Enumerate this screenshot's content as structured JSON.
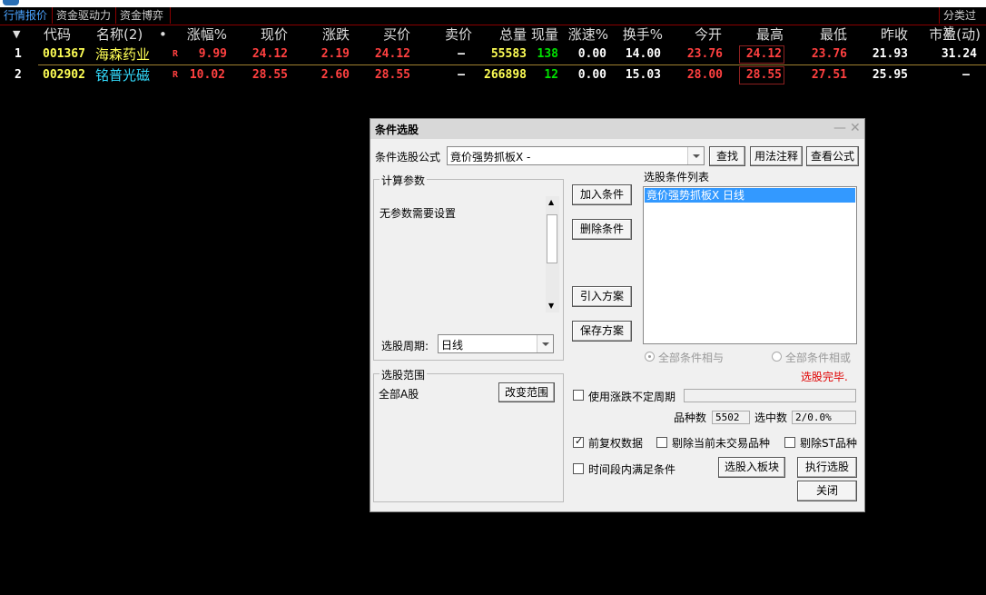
{
  "tabs": [
    "行情报价",
    "资金驱动力",
    "资金博弈"
  ],
  "tab_right": "分类过滤",
  "columns": [
    "代码",
    "名称(2)",
    "•",
    "涨幅%",
    "现价",
    "涨跌",
    "买价",
    "卖价",
    "总量",
    "现量",
    "涨速%",
    "换手%",
    "今开",
    "最高",
    "最低",
    "昨收",
    "市盈(动)"
  ],
  "rows": [
    {
      "idx": "1",
      "code": "001367",
      "name": "海森药业",
      "flag": "R",
      "chg_pct": "9.99",
      "price": "24.12",
      "chg": "2.19",
      "bid": "24.12",
      "ask": "–",
      "vol": "55583",
      "cur_vol": "138",
      "speed": "0.00",
      "turnover": "14.00",
      "open": "23.76",
      "high": "24.12",
      "low": "23.76",
      "prev": "21.93",
      "pe": "31.24"
    },
    {
      "idx": "2",
      "code": "002902",
      "name": "铭普光磁",
      "flag": "R",
      "chg_pct": "10.02",
      "price": "28.55",
      "chg": "2.60",
      "bid": "28.55",
      "ask": "–",
      "vol": "266898",
      "cur_vol": "12",
      "speed": "0.00",
      "turnover": "15.03",
      "open": "28.00",
      "high": "28.55",
      "low": "27.51",
      "prev": "25.95",
      "pe": "–"
    }
  ],
  "dialog": {
    "title": "条件选股",
    "formula_label": "条件选股公式",
    "formula_value": "竟价强势抓板X  -",
    "find": "查找",
    "usage": "用法注释",
    "view_formula": "查看公式",
    "params_group": "计算参数",
    "params_text": "无参数需要设置",
    "period_label": "选股周期:",
    "period_value": "日线",
    "add": "加入条件",
    "delete": "删除条件",
    "import_plan": "引入方案",
    "save_plan": "保存方案",
    "list_label": "选股条件列表",
    "list_item": "竟价强势抓板X   日线",
    "radio_and": "全部条件相与",
    "radio_or": "全部条件相或",
    "status": "选股完毕.",
    "range_group": "选股范围",
    "range_value": "全部A股",
    "change_range": "改变范围",
    "use_period": "使用涨跌不定周期",
    "count_label": "品种数",
    "count_value": "5502",
    "selected_label": "选中数",
    "selected_value": "2/0.0%",
    "fq": "前复权数据",
    "exclude_untraded": "剔除当前未交易品种",
    "exclude_st": "剔除ST品种",
    "time_cond": "时间段内满足条件",
    "to_block": "选股入板块",
    "execute": "执行选股",
    "close": "关闭"
  }
}
